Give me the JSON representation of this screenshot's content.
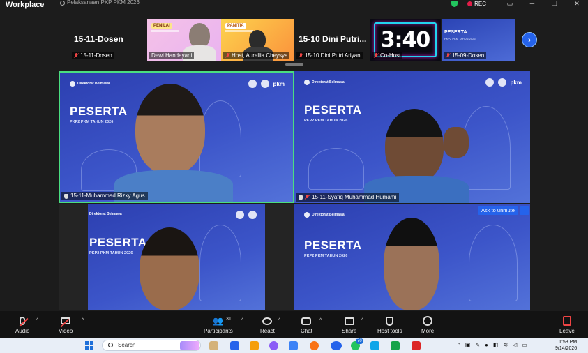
{
  "titlebar": {
    "brand": "Workplace",
    "meeting_title": "Pelaksanaan PKP PKM 2026",
    "rec_label": "REC",
    "controls": [
      "▭",
      "─",
      "❐",
      "✕"
    ]
  },
  "filmstrip": {
    "tiles": [
      {
        "name": "15-11-Dosen",
        "big_label": "15-11-Dosen",
        "muted": true
      },
      {
        "name": "Dewi Handayani",
        "sticker": "PENILAI",
        "muted": false
      },
      {
        "name": "Host, Aurellia Cheysya",
        "sticker": "PANITIA",
        "muted": true
      },
      {
        "name": "15-10 Dini Putri Ariyani",
        "big_label": "15-10 Dini Putri...",
        "muted": true
      },
      {
        "name": "Co-Host",
        "timer": "3:40",
        "muted": true
      },
      {
        "name": "15-09-Dosen",
        "label": "PESERTA",
        "muted": true
      }
    ],
    "next_arrow": "›"
  },
  "background": {
    "org": "Direktorat Belmawa",
    "pkm": "pkm",
    "title": "PESERTA",
    "subtitle": "PKP2 PKM TAHUN 2026"
  },
  "gallery": {
    "videos": [
      {
        "name": "15-11-Muhammad Rizky Agus",
        "active_speaker": true
      },
      {
        "name": "15-11-Syafiq Muhammad Humami",
        "active_speaker": false
      },
      {
        "name": "",
        "active_speaker": false
      },
      {
        "name": "",
        "active_speaker": false
      }
    ],
    "ask_unmute": "Ask to unmute",
    "more": "···"
  },
  "toolbar": {
    "audio": "Audio",
    "video": "Video",
    "participants": "Participants",
    "participants_count": "31",
    "react": "React",
    "chat": "Chat",
    "share": "Share",
    "host_tools": "Host tools",
    "more": "More",
    "leave": "Leave",
    "caret": "^"
  },
  "taskbar": {
    "search_placeholder": "Search",
    "whatsapp_badge": "70",
    "time": "1:53 PM",
    "date": "9/14/2026"
  },
  "colors": {
    "active_speaker_border": "#4ade80",
    "muted_red": "#ef4444",
    "accent_blue": "#2563eb",
    "background_blue": "#3c55c9"
  }
}
